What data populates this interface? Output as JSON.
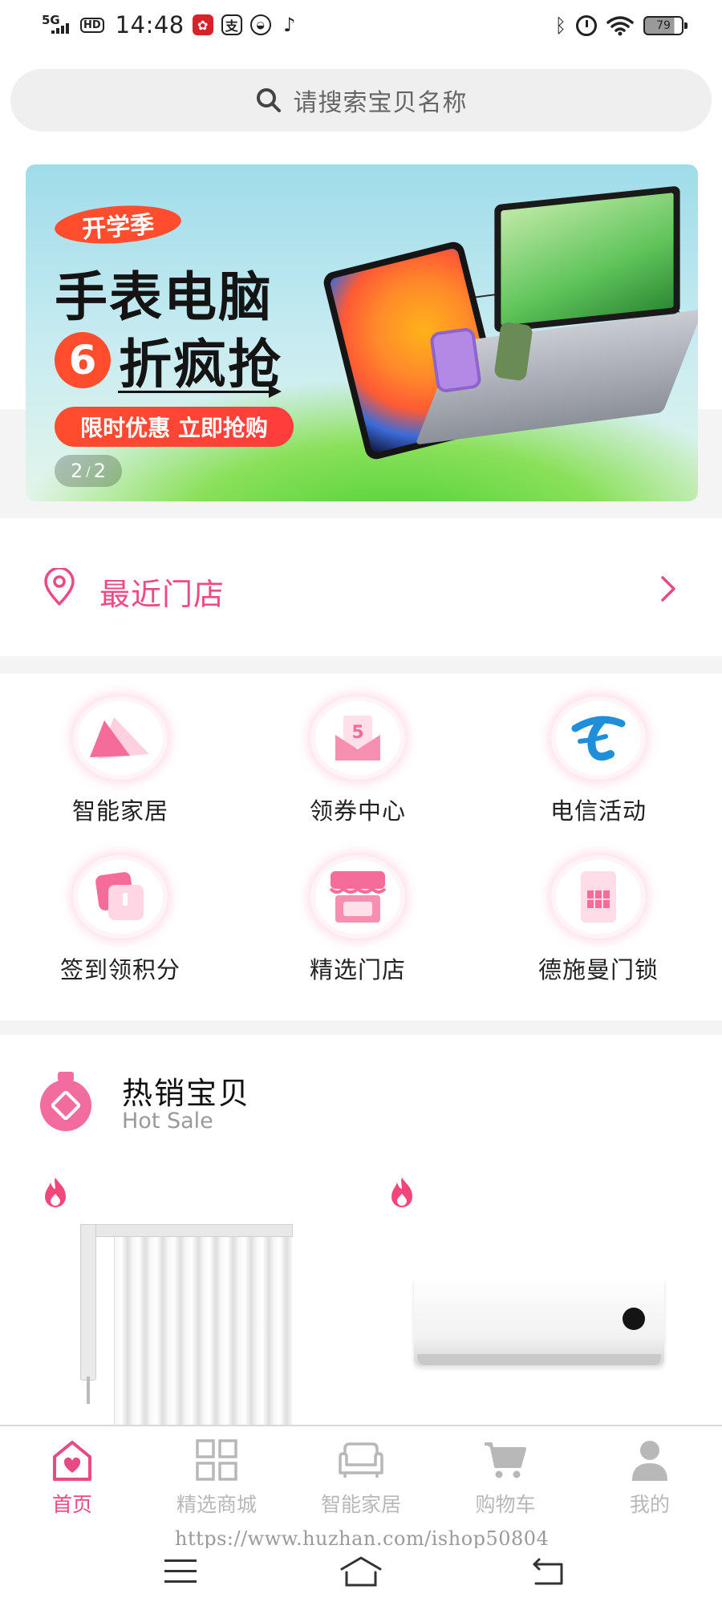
{
  "status_bar": {
    "network": "5G",
    "hd": "HD",
    "time": "14:48",
    "app_icons": [
      "red-app-icon",
      "alipay-icon",
      "cmb-icon",
      "tiktok-icon"
    ],
    "alipay_glyph": "支",
    "battery": "79"
  },
  "search": {
    "placeholder": "请搜索宝贝名称"
  },
  "banner": {
    "badge": "开学季",
    "title_line1": "手表电脑",
    "title_num": "6",
    "title_line2": "折疯抢",
    "cta": "限时优惠 立即抢购",
    "index_current": "2",
    "index_sep": "/",
    "index_total": "2"
  },
  "store": {
    "label": "最近门店"
  },
  "grid": [
    {
      "label": "智能家居",
      "icon": "smart-home-icon"
    },
    {
      "label": "领券中心",
      "icon": "coupon-icon",
      "glyph": "5"
    },
    {
      "label": "电信活动",
      "icon": "telecom-icon"
    },
    {
      "label": "签到领积分",
      "icon": "checkin-icon"
    },
    {
      "label": "精选门店",
      "icon": "shop-icon"
    },
    {
      "label": "德施曼门锁",
      "icon": "door-lock-icon"
    }
  ],
  "hot_sale": {
    "title": "热销宝贝",
    "subtitle": "Hot Sale",
    "products": [
      {
        "image": "smart-curtain"
      },
      {
        "image": "air-conditioner"
      }
    ]
  },
  "tabbar": [
    {
      "label": "首页",
      "icon": "home-icon",
      "active": true
    },
    {
      "label": "精选商城",
      "icon": "grid-icon",
      "active": false
    },
    {
      "label": "智能家居",
      "icon": "sofa-icon",
      "active": false
    },
    {
      "label": "购物车",
      "icon": "cart-icon",
      "active": false
    },
    {
      "label": "我的",
      "icon": "user-icon",
      "active": false
    }
  ],
  "watermark": "https://www.huzhan.com/ishop50804",
  "colors": {
    "accent": "#e84a86",
    "banner_orange": "#ff4d2e",
    "inactive_tab": "#b8b8b8"
  }
}
